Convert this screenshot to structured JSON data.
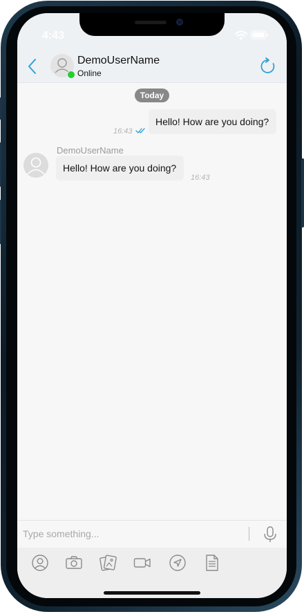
{
  "status_bar": {
    "time": "4:43"
  },
  "header": {
    "contact_name": "DemoUserName",
    "contact_status": "Online"
  },
  "chat": {
    "date_separator": "Today",
    "messages": [
      {
        "direction": "outgoing",
        "text": "Hello! How are you doing?",
        "time": "16:43",
        "read": true
      },
      {
        "direction": "incoming",
        "sender": "DemoUserName",
        "text": "Hello! How are you doing?",
        "time": "16:43"
      }
    ]
  },
  "composer": {
    "placeholder": "Type something..."
  },
  "toolbar": {
    "icons": [
      "contact-icon",
      "camera-icon",
      "gallery-icon",
      "video-icon",
      "location-icon",
      "document-icon"
    ]
  },
  "colors": {
    "accent": "#2f9fd8",
    "online": "#23d12d",
    "date_pill": "#888888",
    "bubble": "#efefef"
  }
}
